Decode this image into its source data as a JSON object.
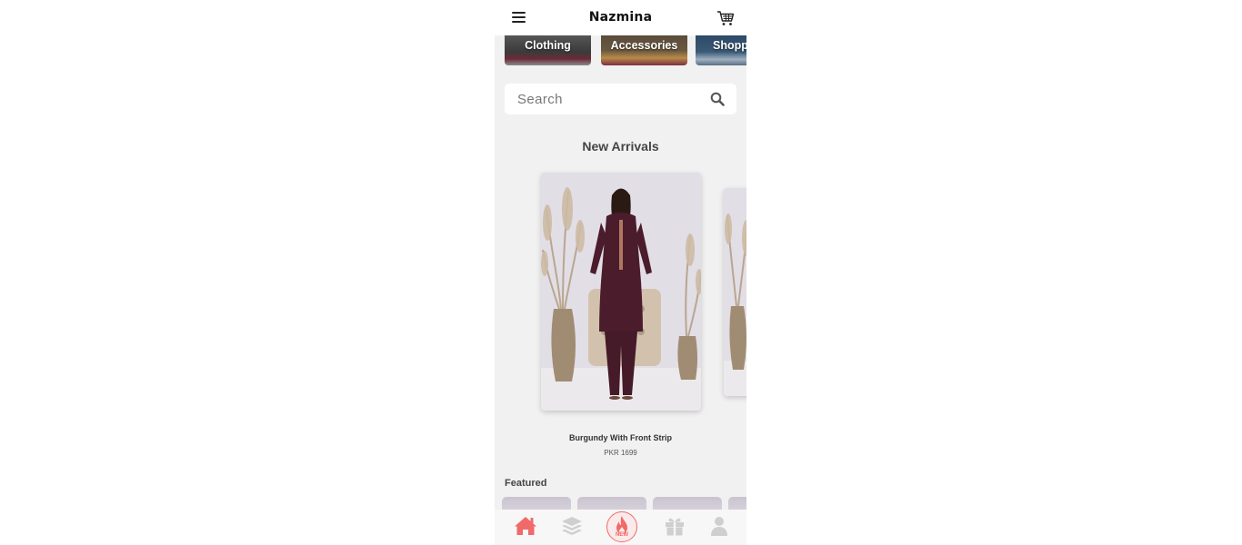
{
  "header": {
    "brand": "Nazmina"
  },
  "categories": [
    {
      "label": "Clothing"
    },
    {
      "label": "Accessories"
    },
    {
      "label": "Shopp"
    }
  ],
  "search": {
    "placeholder": "Search"
  },
  "new_arrivals": {
    "title": "New Arrivals",
    "product": {
      "name": "Burgundy With Front Strip",
      "price": "PKR 1699"
    }
  },
  "featured": {
    "title": "Featured"
  },
  "bottom_nav": {
    "new_label": "NEW",
    "icons": [
      "home-icon",
      "layers-icon",
      "flame-icon",
      "gift-icon",
      "user-icon"
    ]
  },
  "colors": {
    "accent": "#f06a6a",
    "background": "#f1f1f1"
  }
}
